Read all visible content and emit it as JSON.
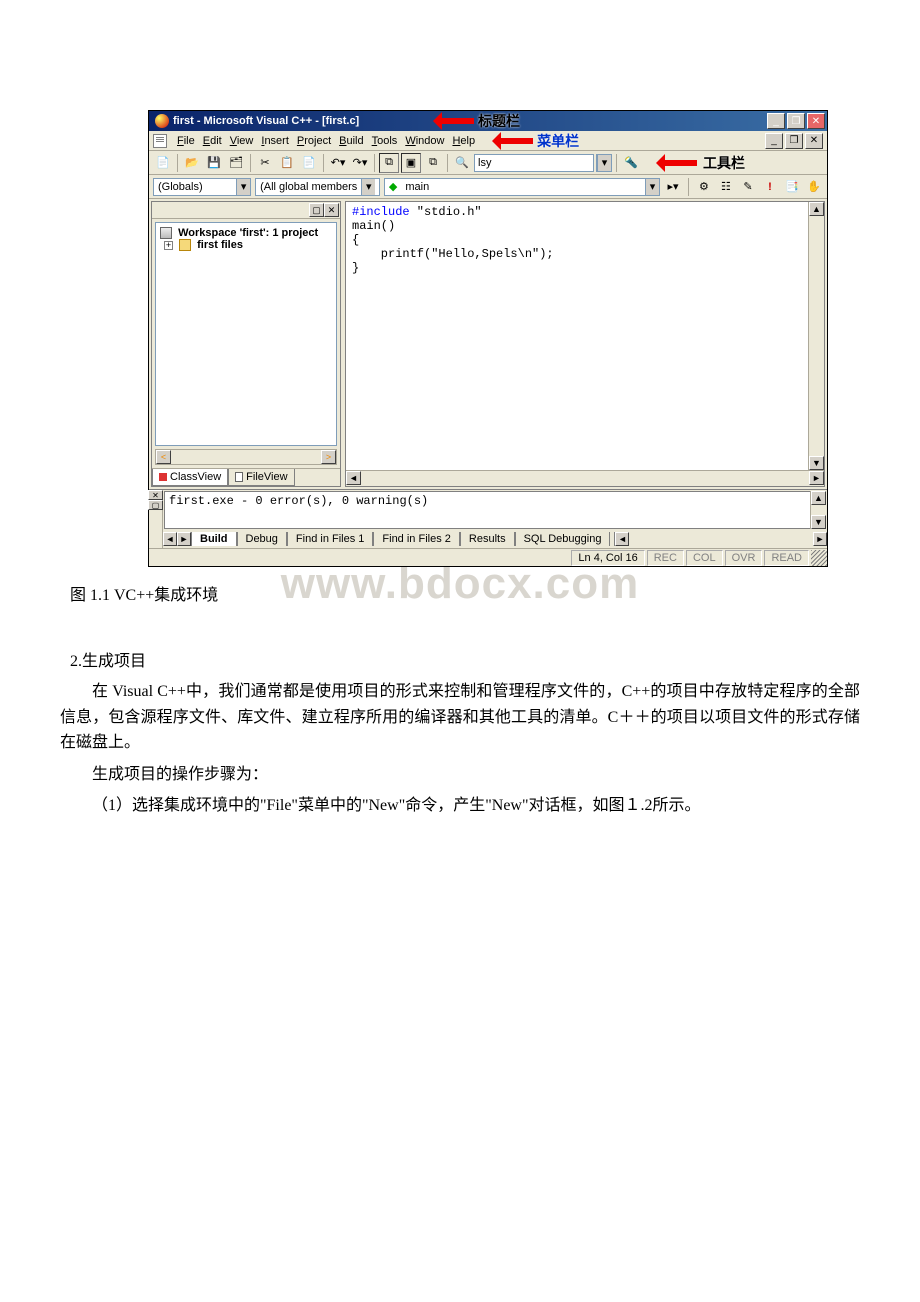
{
  "titlebar": {
    "text": "first - Microsoft Visual C++ - [first.c]",
    "anno": "标题栏"
  },
  "win_buttons": {
    "min": "_",
    "max": "❐",
    "close": "✕"
  },
  "menubar": {
    "anno": "菜单栏",
    "items": [
      {
        "label": "File",
        "u": "F"
      },
      {
        "label": "Edit",
        "u": "E"
      },
      {
        "label": "View",
        "u": "V"
      },
      {
        "label": "Insert",
        "u": "I"
      },
      {
        "label": "Project",
        "u": "P"
      },
      {
        "label": "Build",
        "u": "B"
      },
      {
        "label": "Tools",
        "u": "T"
      },
      {
        "label": "Window",
        "u": "W"
      },
      {
        "label": "Help",
        "u": "H"
      }
    ],
    "mdi": {
      "min": "_",
      "restore": "❐",
      "close": "✕"
    }
  },
  "toolbar": {
    "anno": "工具栏",
    "searchbox": "lsy"
  },
  "members_bar": {
    "scope": "(Globals)",
    "members": "(All global members",
    "symbol": "main"
  },
  "workspace": {
    "root": "Workspace 'first': 1 project",
    "child": "first files",
    "scroll": {
      "left": "<",
      "right": ">"
    },
    "tabs": {
      "class": "ClassView",
      "file": "FileView"
    }
  },
  "editor": {
    "l1a": "#include",
    "l1b": " \"stdio.h\"",
    "l2": "main()",
    "l3": "{",
    "l4": "    printf(\"Hello,Spels\\n\");",
    "l5": "}",
    "hscroll": {
      "left": "◄",
      "right": "►"
    },
    "vscroll": {
      "up": "▲",
      "down": "▼"
    }
  },
  "output": {
    "text": "first.exe - 0 error(s), 0 warning(s)",
    "nav": {
      "prev": "◄",
      "next": "►"
    },
    "tabs": {
      "build": "Build",
      "debug": "Debug",
      "f1": "Find in Files 1",
      "f2": "Find in Files 2",
      "results": "Results",
      "t5": "SQL Debugging"
    },
    "gutter": {
      "close": "✕",
      "pin": "▢"
    },
    "hscroll": {
      "left": "◄",
      "right": "►"
    },
    "vscroll": {
      "up": "▲",
      "down": "▼"
    }
  },
  "statusbar": {
    "pos": "Ln 4, Col 16",
    "rec": "REC",
    "col": "COL",
    "ovr": "OVR",
    "read": "READ"
  },
  "doc": {
    "watermark": "www.bdocx.com",
    "caption": "图 1.1 VC++集成环境",
    "sec2": "2.生成项目",
    "p1": "在 Visual C++中，我们通常都是使用项目的形式来控制和管理程序文件的，C++的项目中存放特定程序的全部信息，包含源程序文件、库文件、建立程序所用的编译器和其他工具的清单。C＋＋的项目以项目文件的形式存储在磁盘上。",
    "p2": "生成项目的操作步骤为：",
    "p3": "（1）选择集成环境中的\"File\"菜单中的\"New\"命令，产生\"New\"对话框，如图１.2所示。"
  }
}
